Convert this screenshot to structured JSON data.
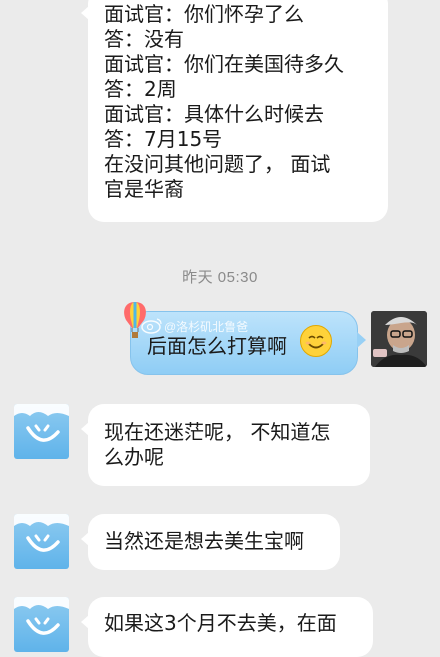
{
  "messages": {
    "m1": {
      "lines": [
        "面试官：你们怀孕了么",
        "答：没有",
        "面试官：你们在美国待多久",
        "答：2周",
        "面试官：具体什么时候去",
        "答：7月15号",
        "在没问其他问题了， 面试",
        "官是华裔"
      ]
    },
    "timestamp": "昨天 05:30",
    "sent": {
      "text": "后面怎么打算啊"
    },
    "m2": {
      "lines": [
        "现在还迷茫呢， 不知道怎",
        "么办呢"
      ]
    },
    "m3": {
      "lines": [
        "当然还是想去美生宝啊"
      ]
    },
    "m4": {
      "lines": [
        "如果这3个月不去美，在面"
      ]
    }
  },
  "watermark": {
    "text": "@洛杉矶北鲁爸"
  },
  "colors": {
    "background": "#ebebeb",
    "bubble_left": "#ffffff",
    "bubble_right": "#a6d8f8",
    "timestamp": "#8a8a8a"
  },
  "icons": {
    "left_avatar": "sky-cloud-smile-avatar",
    "right_avatar": "user-photo-avatar",
    "emoji": "smiley-emoji-icon",
    "balloon": "hot-air-balloon-icon",
    "weibo": "weibo-logo-icon"
  }
}
